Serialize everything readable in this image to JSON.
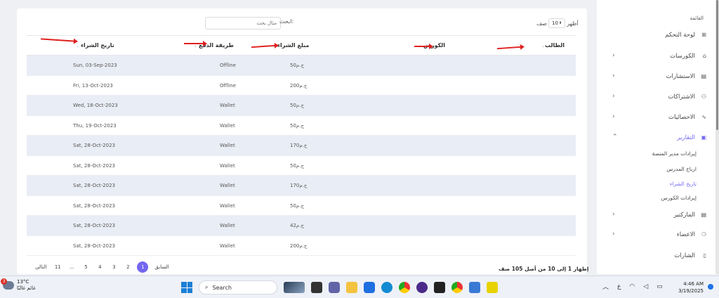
{
  "table": {
    "search_label": "ابحث:",
    "search_placeholder": "مثال بحث",
    "show_label": "أظهر",
    "show_value": "10",
    "rows_label": "صف",
    "columns": {
      "student": "الطالب",
      "course": "الكورس",
      "amount": "مبلغ الشراء",
      "method": "طريقة الدفع",
      "date": "تاريخ الشراء"
    },
    "rows": [
      {
        "amount": "50ج.م",
        "method": "Offline",
        "date": "Sun, 03-Sep-2023"
      },
      {
        "amount": "200ج.م",
        "method": "Offline",
        "date": "Fri, 13-Oct-2023"
      },
      {
        "amount": "50ج.م",
        "method": "Wallet",
        "date": "Wed, 18-Oct-2023"
      },
      {
        "amount": "50ج.م",
        "method": "Wallet",
        "date": "Thu, 19-Oct-2023"
      },
      {
        "amount": "170ج.م",
        "method": "Wallet",
        "date": "Sat, 28-Oct-2023"
      },
      {
        "amount": "50ج.م",
        "method": "Wallet",
        "date": "Sat, 28-Oct-2023"
      },
      {
        "amount": "170ج.م",
        "method": "Wallet",
        "date": "Sat, 28-Oct-2023"
      },
      {
        "amount": "50ج.م",
        "method": "Wallet",
        "date": "Sat, 28-Oct-2023"
      },
      {
        "amount": "42ج.م",
        "method": "Wallet",
        "date": "Sat, 28-Oct-2023"
      },
      {
        "amount": "200ج.م",
        "method": "Wallet",
        "date": "Sat, 28-Oct-2023"
      }
    ],
    "info": "إظهار 1 إلى 10 من أصل 105 صف",
    "pagination": {
      "next": "التالي",
      "prev": "السابق",
      "pages": [
        "11",
        "...",
        "5",
        "4",
        "3",
        "2",
        "1"
      ],
      "active": "1"
    }
  },
  "sidebar": {
    "section": "القائمة",
    "items": [
      {
        "label": "لوحة التحكم",
        "icon": "dashboard-icon"
      },
      {
        "label": "الكورسات",
        "icon": "courses-icon"
      },
      {
        "label": "الاستشارات",
        "icon": "consultations-icon"
      },
      {
        "label": "الاشتراكات",
        "icon": "subscriptions-icon"
      },
      {
        "label": "الاحصائيات",
        "icon": "stats-icon"
      },
      {
        "label": "التقارير",
        "icon": "reports-icon"
      },
      {
        "label": "الماركتير",
        "icon": "marketer-icon"
      },
      {
        "label": "الاعضاء",
        "icon": "members-icon"
      },
      {
        "label": "الشارات",
        "icon": "badges-icon"
      }
    ],
    "sub_items": [
      "إيرادات مدير المنصة",
      "ارباح المدرس",
      "تاريخ الشراء",
      "إيرادات الكورس"
    ]
  },
  "taskbar": {
    "temperature": "13°C",
    "weather_text": "غائم غالبًا",
    "weather_badge": "3",
    "search": "Search",
    "lang": "ع",
    "time": "4:46 AM",
    "date": "3/19/2025"
  },
  "colors": {
    "accent": "#7367f0",
    "arrow": "#e02020",
    "stripe": "#e9edf5"
  }
}
